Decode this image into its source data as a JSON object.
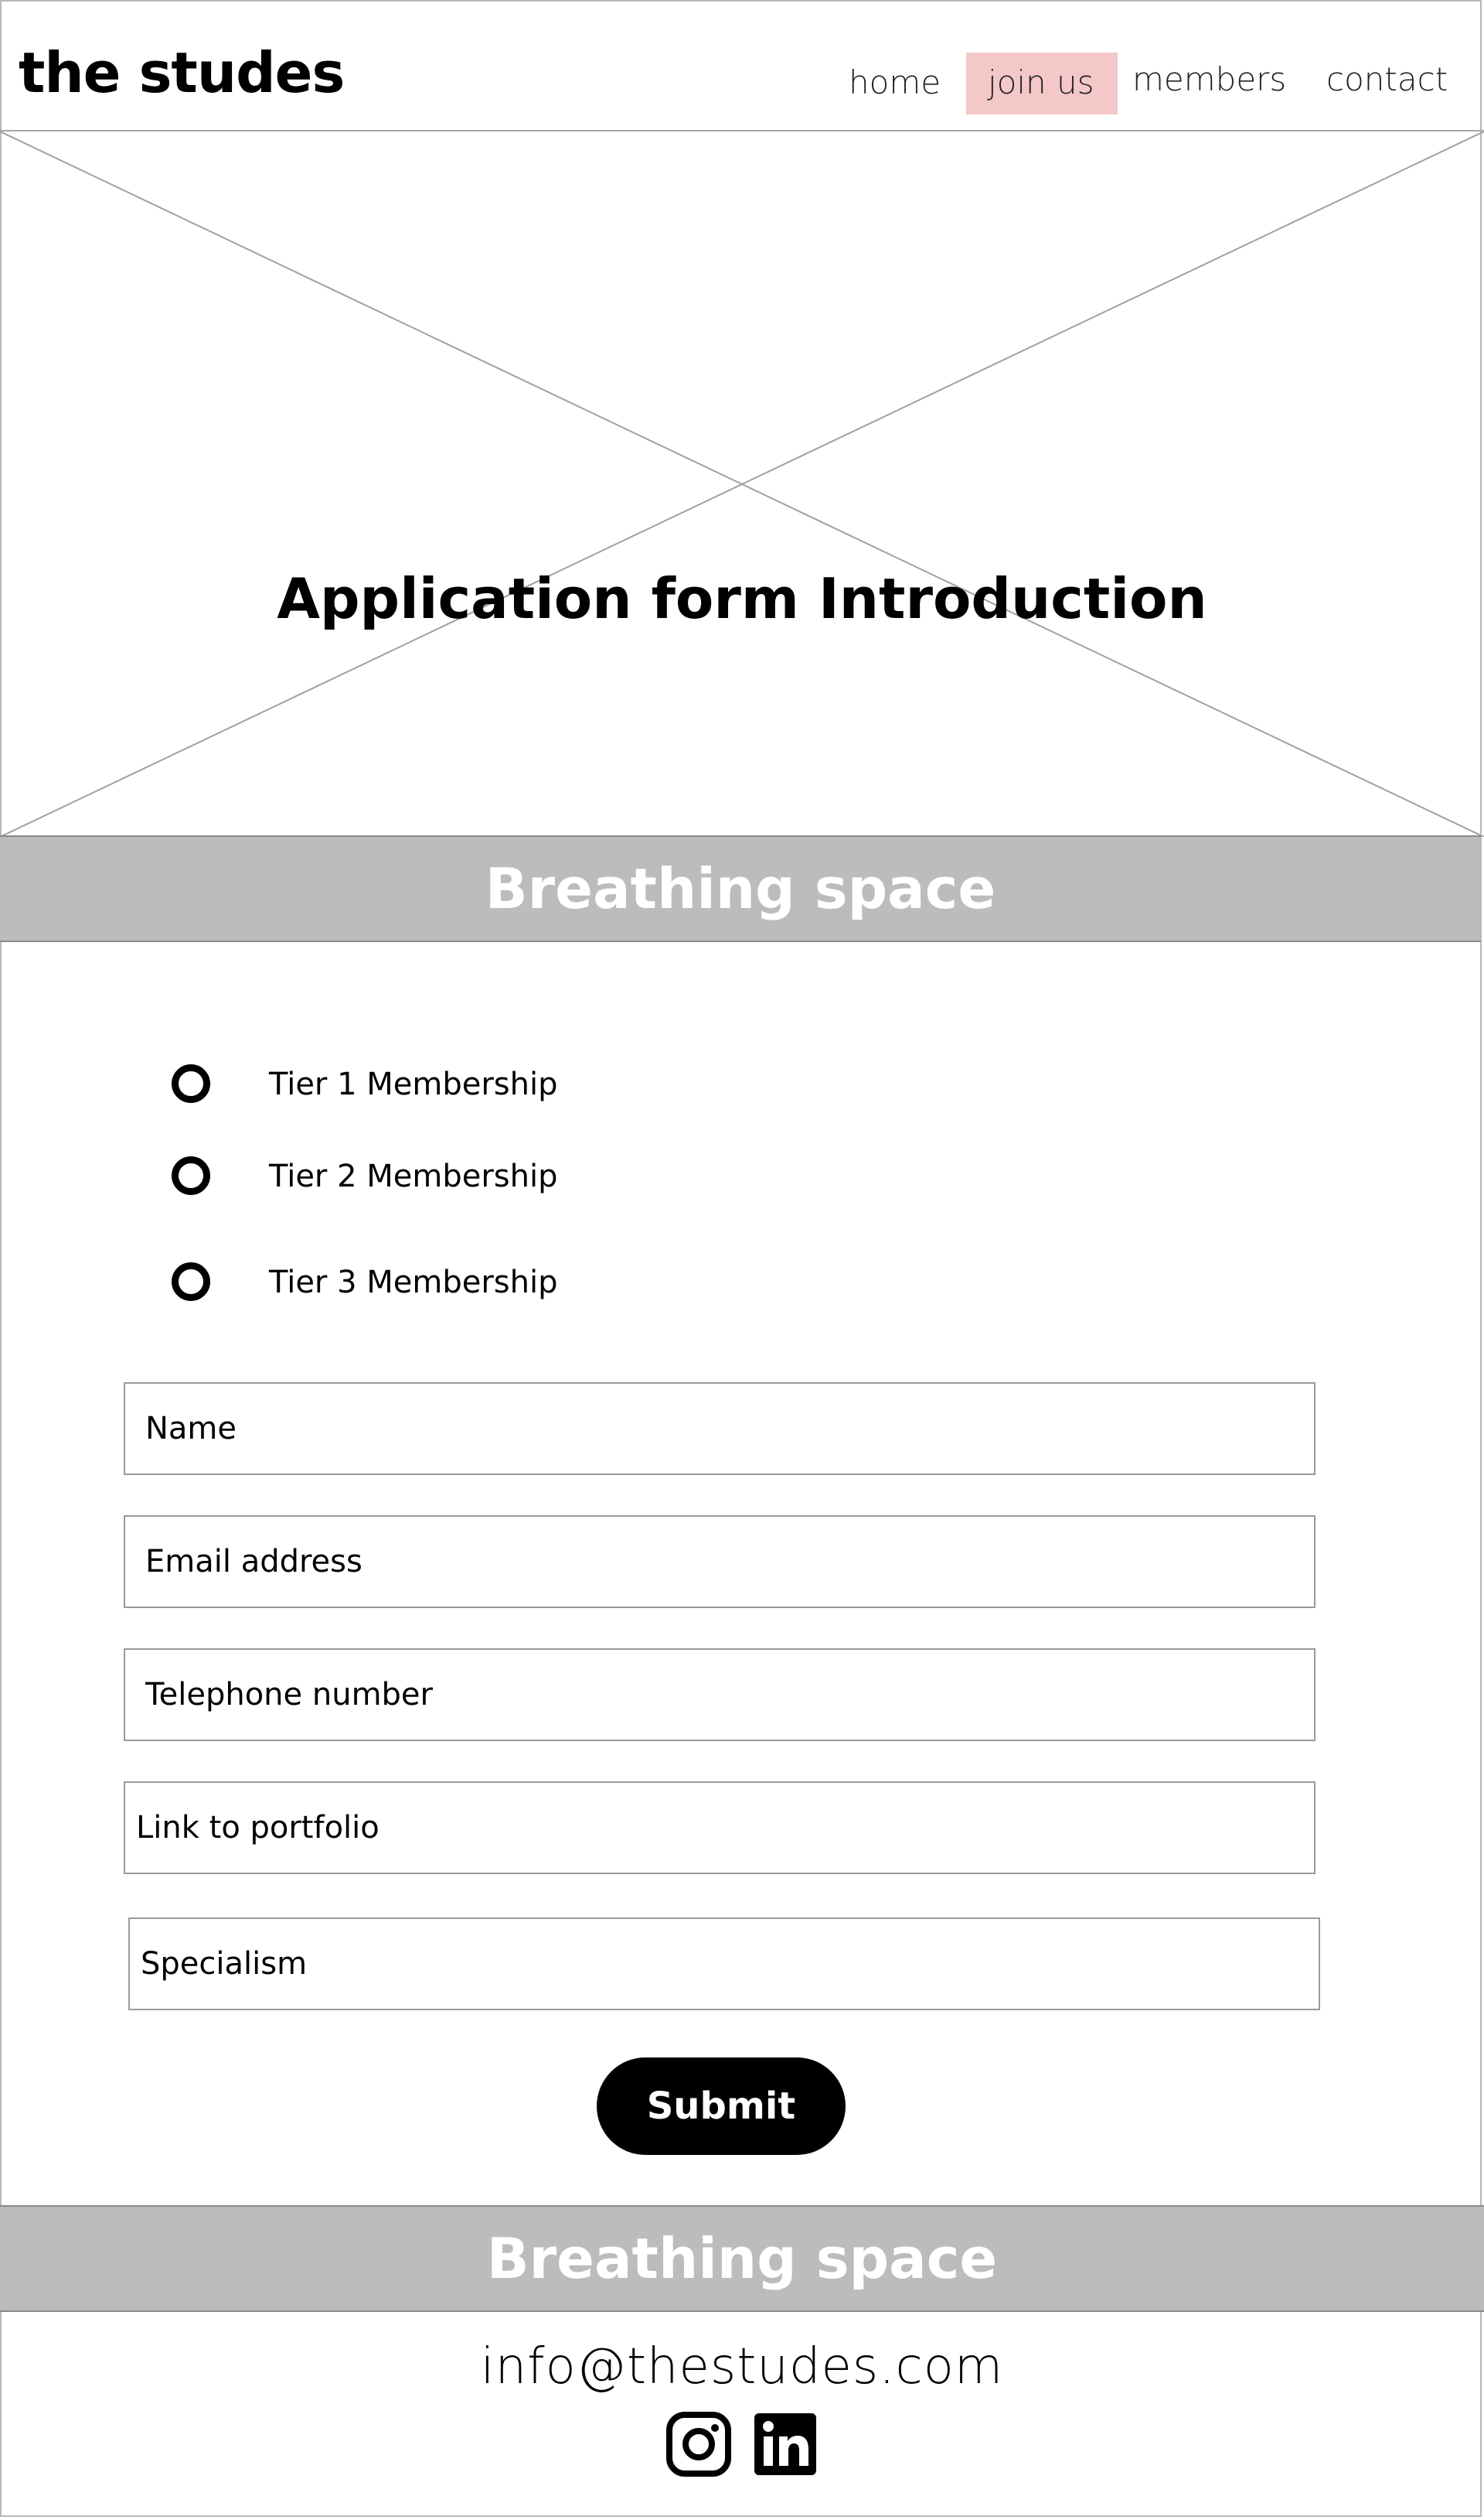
{
  "header": {
    "logo": "the studes",
    "nav": {
      "home": "home",
      "join": "join us",
      "members": "members",
      "contact": "contact"
    },
    "active_color": "#f4c7c8"
  },
  "hero": {
    "title": "Application form Introduction"
  },
  "bands": {
    "top": "Breathing space",
    "bottom": "Breathing space",
    "color": "#bcbcbc"
  },
  "form": {
    "options": [
      "Tier 1 Membership",
      "Tier 2 Membership",
      "Tier 3 Membership"
    ],
    "fields": {
      "name": "Name",
      "email": "Email address",
      "telephone": "Telephone number",
      "portfolio": "Link to portfolio",
      "specialism": "Specialism"
    },
    "submit_label": "Submit"
  },
  "footer": {
    "email": "info@thestudes.com",
    "icons": [
      "instagram-icon",
      "linkedin-icon"
    ]
  }
}
